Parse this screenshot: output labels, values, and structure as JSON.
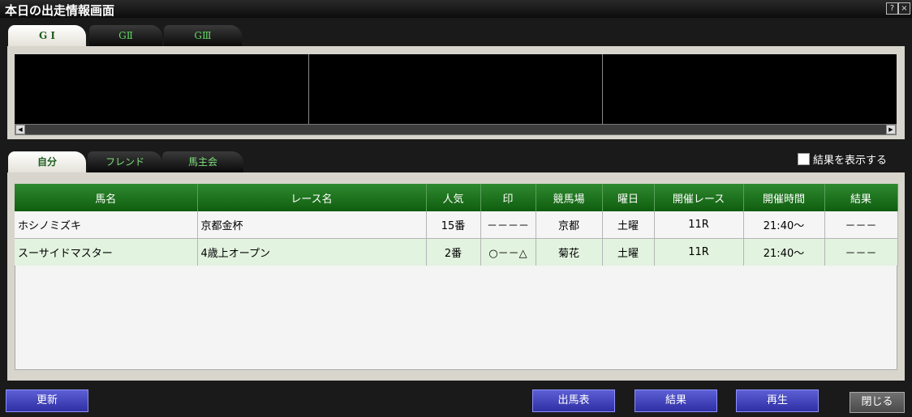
{
  "window": {
    "title": "本日の出走情報画面",
    "help_label": "?",
    "close_label": "×"
  },
  "grade_tabs": [
    {
      "label": "G I",
      "active": true
    },
    {
      "label": "GⅡ",
      "active": false
    },
    {
      "label": "GⅢ",
      "active": false
    }
  ],
  "scroll": {
    "left": "◀",
    "right": "▶"
  },
  "list_tabs": [
    {
      "label": "自分",
      "active": true
    },
    {
      "label": "フレンド",
      "active": false
    },
    {
      "label": "馬主会",
      "active": false
    }
  ],
  "show_results": {
    "label": "結果を表示する",
    "checked": false
  },
  "table": {
    "headers": [
      "馬名",
      "レース名",
      "人気",
      "印",
      "競馬場",
      "曜日",
      "開催レース",
      "開催時間",
      "結果"
    ],
    "rows": [
      [
        "ホシノミズキ",
        "京都金杯",
        "15番",
        "－－－－",
        "京都",
        "土曜",
        "11R",
        "21:40～",
        "－－－"
      ],
      [
        "スーサイドマスター",
        "4歳上オープン",
        "2番",
        "○－－△",
        "菊花",
        "土曜",
        "11R",
        "21:40～",
        "－－－"
      ]
    ]
  },
  "buttons": {
    "refresh": "更新",
    "race_card": "出馬表",
    "result": "結果",
    "replay": "再生",
    "close": "閉じる"
  },
  "colors": {
    "accent_green": "#0f5d0f",
    "button_blue": "#3a3bb8",
    "selected_row": "#e2f3df"
  }
}
